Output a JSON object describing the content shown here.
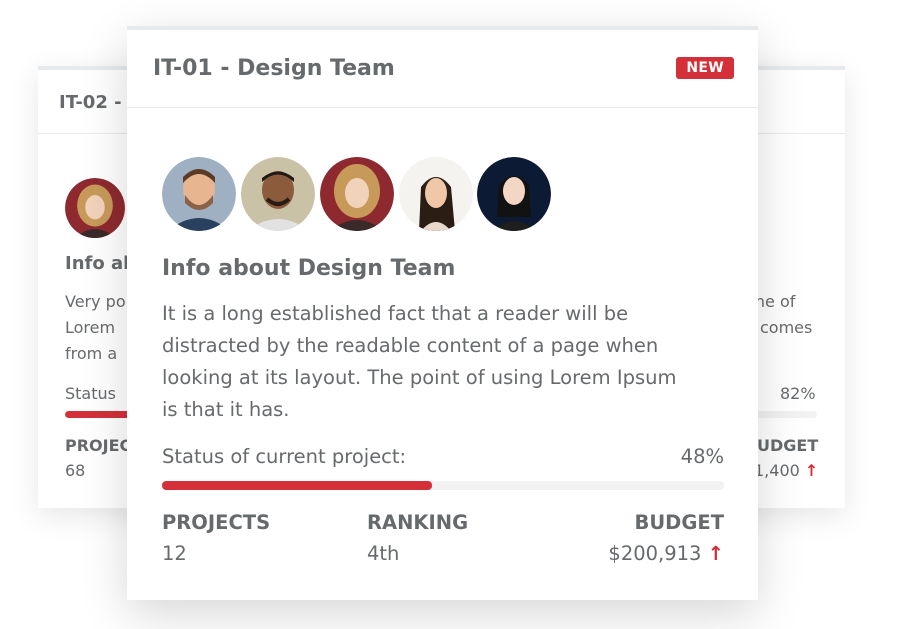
{
  "back_card": {
    "title": "IT-02 - (",
    "info_title": "Info al",
    "desc_left": [
      "Very po",
      "Lorem ",
      "from a "
    ],
    "desc_right": [
      "line of",
      "comes"
    ],
    "status_label": "Status ",
    "status_percent": "82%",
    "progress": 0.82,
    "projects_label": "PROJEC",
    "projects_value": "68",
    "budget_label": "UDGET",
    "budget_value": "1,400",
    "budget_trend_icon": "arrow-up-icon"
  },
  "front_card": {
    "title": "IT-01 - Design Team",
    "badge": "NEW",
    "avatars": [
      "avatar-man-beard",
      "avatar-man-dark",
      "avatar-woman-curly",
      "avatar-woman-long-hair",
      "avatar-woman-dark-bg"
    ],
    "info_title": "Info about Design Team",
    "description_lines": [
      "It is a long established fact that a reader will be",
      "distracted by the readable content of a page when",
      "looking at its layout. The point of using Lorem Ipsum",
      "is that it has."
    ],
    "status_label": "Status of current project:",
    "status_percent": "48%",
    "progress": 0.48,
    "stats": {
      "projects_label": "PROJECTS",
      "projects_value": "12",
      "ranking_label": "RANKING",
      "ranking_value": "4th",
      "budget_label": "BUDGET",
      "budget_value": "$200,913",
      "budget_trend_icon": "arrow-up-icon"
    }
  },
  "colors": {
    "accent": "#d3303a",
    "text": "#676a6c",
    "border": "#e7eaec"
  }
}
